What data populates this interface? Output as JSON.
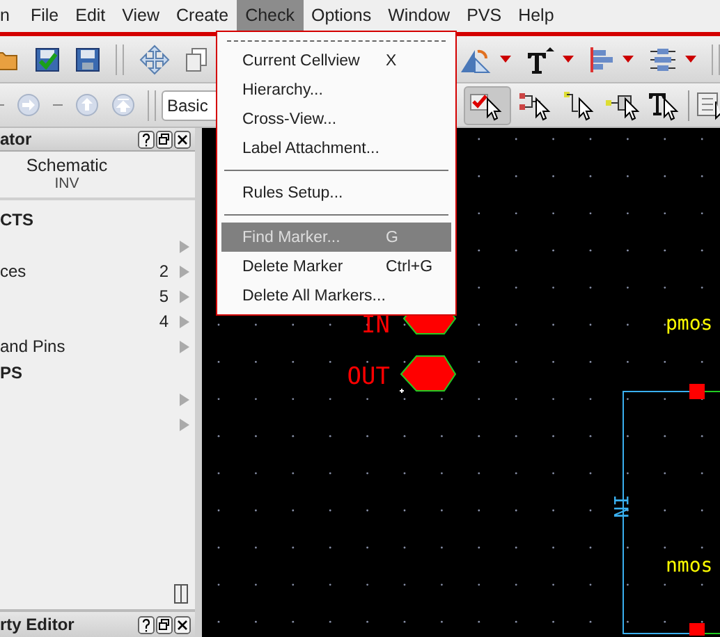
{
  "menubar": [
    {
      "label": "n",
      "selected": false
    },
    {
      "label": "File",
      "selected": false
    },
    {
      "label": "Edit",
      "selected": false
    },
    {
      "label": "View",
      "selected": false
    },
    {
      "label": "Create",
      "selected": false
    },
    {
      "label": "Check",
      "selected": true
    },
    {
      "label": "Options",
      "selected": false
    },
    {
      "label": "Window",
      "selected": false
    },
    {
      "label": "PVS",
      "selected": false
    },
    {
      "label": "Help",
      "selected": false
    }
  ],
  "toolbar": {
    "combobox": "Basic"
  },
  "check_menu": [
    {
      "kind": "tearoff"
    },
    {
      "kind": "item",
      "label": "Current Cellview",
      "shortcut": "X",
      "selected": false
    },
    {
      "kind": "item",
      "label": "Hierarchy...",
      "selected": false
    },
    {
      "kind": "item",
      "label": "Cross-View...",
      "selected": false
    },
    {
      "kind": "item",
      "label": "Label Attachment...",
      "selected": false
    },
    {
      "kind": "separator"
    },
    {
      "kind": "item",
      "label": "Rules Setup...",
      "selected": false
    },
    {
      "kind": "separator"
    },
    {
      "kind": "item",
      "label": "Find Marker...",
      "shortcut": "G",
      "selected": true
    },
    {
      "kind": "item",
      "label": "Delete Marker",
      "shortcut": "Ctrl+G",
      "selected": false
    },
    {
      "kind": "item",
      "label": "Delete All Markers...",
      "selected": false
    }
  ],
  "navigator": {
    "title": "ator",
    "view": "Schematic",
    "cell": "INV",
    "rows": [
      {
        "kind": "heading",
        "label": "CTS"
      },
      {
        "kind": "row"
      },
      {
        "kind": "row",
        "label": "ces",
        "count": "2"
      },
      {
        "kind": "row",
        "count": "5"
      },
      {
        "kind": "row",
        "count": "4"
      },
      {
        "kind": "row",
        "label": "and Pins"
      },
      {
        "kind": "heading",
        "label": "PS"
      },
      {
        "kind": "row"
      },
      {
        "kind": "row"
      }
    ]
  },
  "property_editor": {
    "title": "rty Editor"
  },
  "canvas": {
    "pins": [
      {
        "label": "IN"
      },
      {
        "label": "OUT"
      }
    ],
    "devices": [
      {
        "label": "pmos"
      },
      {
        "label": "nmos"
      }
    ],
    "wire_label": "IN"
  }
}
